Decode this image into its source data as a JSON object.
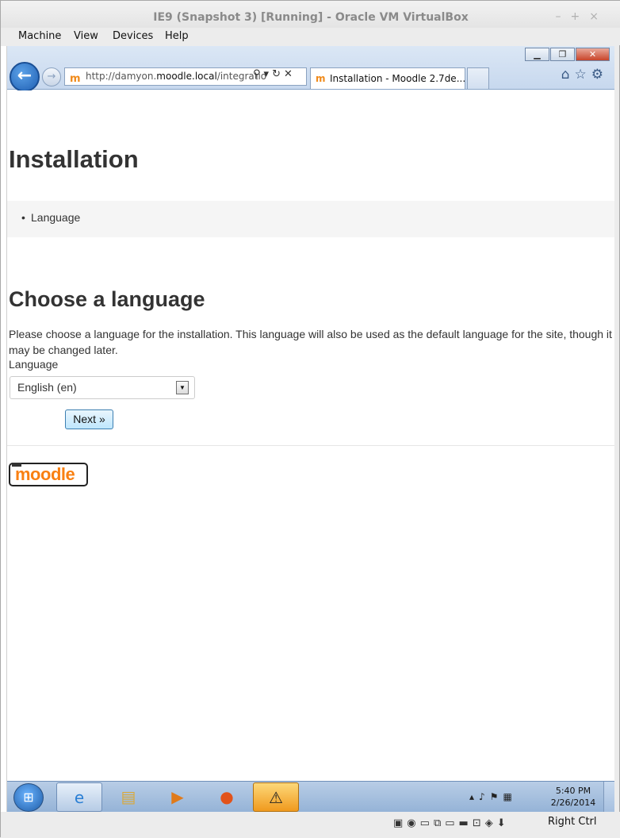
{
  "vbox": {
    "title": "IE9 (Snapshot 3) [Running] - Oracle VM VirtualBox",
    "menu": [
      "Machine",
      "View",
      "Devices",
      "Help"
    ],
    "host_key": "Right Ctrl"
  },
  "ie": {
    "address": {
      "prefix": "http://damyon.",
      "domain": "moodle.local",
      "suffix": "/integratio"
    },
    "tab_title": "Installation - Moodle 2.7de..."
  },
  "page": {
    "heading": "Installation",
    "breadcrumb": [
      "Language"
    ],
    "section_heading": "Choose a language",
    "intro": "Please choose a language for the installation. This language will also be used as the default language for the site, though it may be changed later.",
    "language_label": "Language",
    "language_selected": "English (en)",
    "next_button": "Next »",
    "logo_text": "moodle"
  },
  "taskbar": {
    "time": "5:40 PM",
    "date": "2/26/2014"
  },
  "icons": [
    "back-icon",
    "forward-icon",
    "search-icon",
    "refresh-icon",
    "stop-icon",
    "home-icon",
    "favorites-icon",
    "tools-icon",
    "start-icon",
    "ie-icon",
    "explorer-icon",
    "media-player-icon",
    "firefox-icon",
    "warning-icon"
  ],
  "colors": {
    "moodle_orange": "#f98012",
    "ie_chrome": "#c7d8ee",
    "next_button": "#bee6fd"
  }
}
